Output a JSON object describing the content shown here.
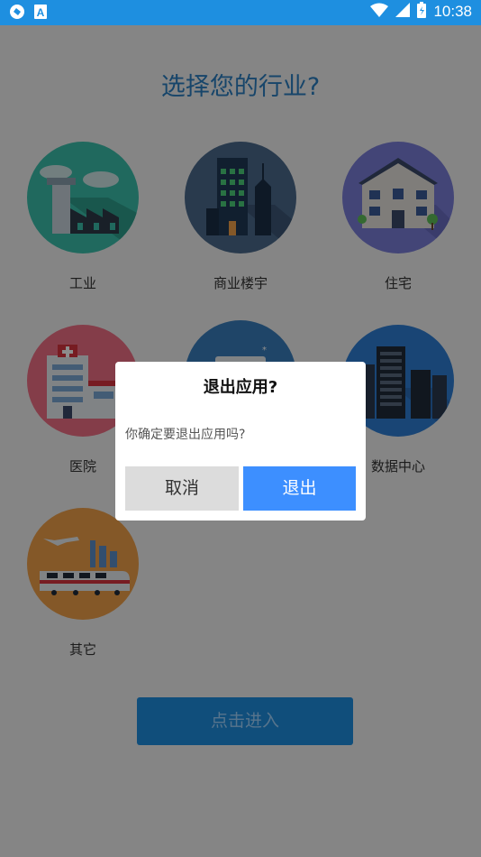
{
  "status_bar": {
    "time": "10:38"
  },
  "page": {
    "title": "选择您的行业?",
    "industries": [
      {
        "label": "工业",
        "icon": "factory-icon",
        "color": "#3bbfab"
      },
      {
        "label": "商业楼宇",
        "icon": "office-building-icon",
        "color": "#4b6a8c"
      },
      {
        "label": "住宅",
        "icon": "residential-house-icon",
        "color": "#7b7fd9"
      },
      {
        "label": "医院",
        "icon": "hospital-icon",
        "color": "#f06f86"
      },
      {
        "label": "",
        "icon": "cold-storage-icon",
        "color": "#3a7fbd"
      },
      {
        "label": "数据中心",
        "icon": "server-rack-icon",
        "color": "#2f7fd6"
      },
      {
        "label": "其它",
        "icon": "transport-icon",
        "color": "#f0a04a"
      }
    ],
    "enter_button": "点击进入"
  },
  "dialog": {
    "title": "退出应用?",
    "message": "你确定要退出应用吗?",
    "cancel_label": "取消",
    "exit_label": "退出"
  },
  "colors": {
    "accent": "#1e8fe0",
    "dialog_button": "#3d8fff"
  }
}
